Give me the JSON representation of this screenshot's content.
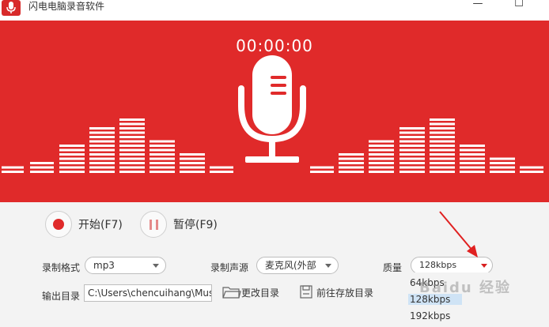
{
  "window": {
    "title": "闪电电脑录音软件",
    "minimize_glyph": "—",
    "maximize_glyph": "☐"
  },
  "banner": {
    "timer": "00:00:00",
    "background": "#e02a2a",
    "mic_icon": "microphone-icon"
  },
  "controls": {
    "start_label": "开始(F7)",
    "pause_label": "暂停(F9)",
    "format_label": "录制格式",
    "format_value": "mp3",
    "source_label": "录制声源",
    "source_value": "麦克风(外部",
    "quality_label": "质量",
    "quality_value": "128kbps",
    "output_label": "输出目录",
    "output_value": "C:\\Users\\chencuihang\\Music",
    "change_dir_label": "更改目录",
    "open_dir_label": "前往存放目录"
  },
  "quality_options": [
    "64kbps",
    "128kbps",
    "192kbps"
  ],
  "watermark": "Baidu 经验"
}
